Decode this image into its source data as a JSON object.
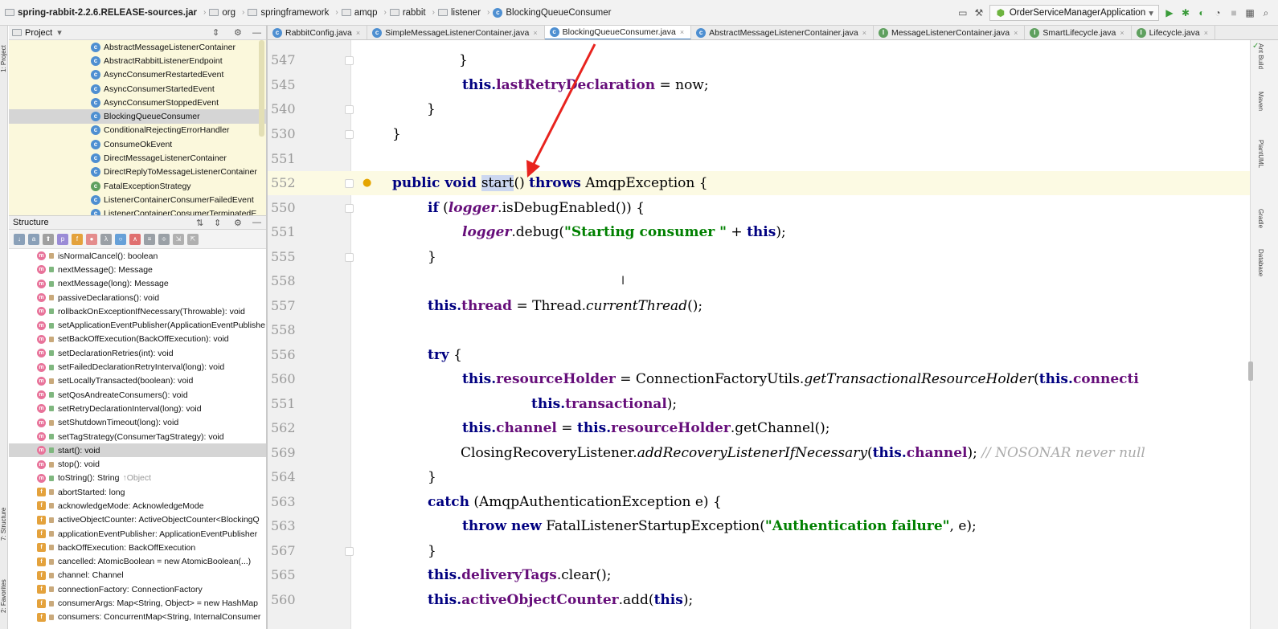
{
  "breadcrumbs": [
    "spring-rabbit-2.2.6.RELEASE-sources.jar",
    "org",
    "springframework",
    "amqp",
    "rabbit",
    "listener",
    "BlockingQueueConsumer"
  ],
  "run_config": "OrderServiceManagerApplication",
  "left_strip": {
    "project": "1: Project",
    "structure": "7: Structure",
    "favorites": "2: Favorites"
  },
  "project_panel": {
    "title": "Project",
    "items": [
      "AbstractMessageListenerContainer",
      "AbstractRabbitListenerEndpoint",
      "AsyncConsumerRestartedEvent",
      "AsyncConsumerStartedEvent",
      "AsyncConsumerStoppedEvent",
      "BlockingQueueConsumer",
      "ConditionalRejectingErrorHandler",
      "ConsumeOkEvent",
      "DirectMessageListenerContainer",
      "DirectReplyToMessageListenerContainer",
      "FatalExceptionStrategy",
      "ListenerContainerConsumerFailedEvent",
      "ListenerContainerConsumerTerminatedE"
    ],
    "selected_index": 5
  },
  "structure_panel": {
    "title": "Structure",
    "methods": [
      "isNormalCancel(): boolean",
      "nextMessage(): Message",
      "nextMessage(long): Message",
      "passiveDeclarations(): void",
      "rollbackOnExceptionIfNecessary(Throwable): void",
      "setApplicationEventPublisher(ApplicationEventPublishe",
      "setBackOffExecution(BackOffExecution): void",
      "setDeclarationRetries(int): void",
      "setFailedDeclarationRetryInterval(long): void",
      "setLocallyTransacted(boolean): void",
      "setQosAndreateConsumers(): void",
      "setRetryDeclarationInterval(long): void",
      "setShutdownTimeout(long): void",
      "setTagStrategy(ConsumerTagStrategy): void",
      "start(): void",
      "stop(): void",
      "toString(): String"
    ],
    "tostring_suffix": "↑Object",
    "selected_index": 14,
    "fields": [
      "abortStarted: long",
      "acknowledgeMode: AcknowledgeMode",
      "activeObjectCounter: ActiveObjectCounter<BlockingQ",
      "applicationEventPublisher: ApplicationEventPublisher",
      "backOffExecution: BackOffExecution",
      "cancelled: AtomicBoolean = new AtomicBoolean(...)",
      "channel: Channel",
      "connectionFactory: ConnectionFactory",
      "consumerArgs: Map<String, Object> = new HashMap",
      "consumers: ConcurrentMap<String, InternalConsumer"
    ]
  },
  "tabs": [
    {
      "label": "RabbitConfig.java",
      "icon": "C"
    },
    {
      "label": "SimpleMessageListenerContainer.java",
      "icon": "C"
    },
    {
      "label": "BlockingQueueConsumer.java",
      "icon": "C",
      "active": true
    },
    {
      "label": "AbstractMessageListenerContainer.java",
      "icon": "C"
    },
    {
      "label": "MessageListenerContainer.java",
      "icon": "I"
    },
    {
      "label": "SmartLifecycle.java",
      "icon": "I"
    },
    {
      "label": "Lifecycle.java",
      "icon": "I"
    }
  ],
  "right_strip": [
    "Ant Build",
    "Maven",
    "PlantUML",
    "Gradle",
    "Database"
  ],
  "code": {
    "line_numbers": [
      "547",
      "545",
      "540",
      "530",
      "551",
      "552",
      "550",
      "551",
      "555",
      "558",
      "557",
      "558",
      "556",
      "560",
      "551",
      "562",
      "569",
      "564",
      "563",
      "563",
      "567",
      "565",
      "560"
    ],
    "t_ln547": "}",
    "t_ln545a": "this.",
    "t_ln545b": "lastRetryDeclaration",
    "t_ln545c": " = now;",
    "t_ln540": "}",
    "t_ln530": "}",
    "t_ln552a": "public void ",
    "t_ln552b": "start",
    "t_ln552c": "() ",
    "t_ln552d": "throws",
    "t_ln552e": " AmqpException {",
    "t_ln550a": "if",
    "t_ln550b": " (",
    "t_ln550c": "logger",
    "t_ln550d": ".isDebugEnabled()) {",
    "t_ln551a": "logger",
    "t_ln551b": ".debug(",
    "t_ln551c": "\"Starting consumer \"",
    "t_ln551d": " + ",
    "t_ln551e": "this",
    "t_ln551f": ");",
    "t_ln555": "}",
    "t_ln557a": "this.",
    "t_ln557b": "thread",
    "t_ln557c": " = Thread.",
    "t_ln557d": "currentThread",
    "t_ln557e": "();",
    "t_ln556a": "try",
    "t_ln556b": " {",
    "t_ln560a": "this.",
    "t_ln560b": "resourceHolder",
    "t_ln560c": " = ConnectionFactoryUtils.",
    "t_ln560d": "getTransactionalResourceHolder",
    "t_ln560e": "(",
    "t_ln560f": "this.",
    "t_ln560g": "connecti",
    "t_ln551ba": "this.",
    "t_ln551bb": "transactional",
    "t_ln551bc": ");",
    "t_ln562a": "this.",
    "t_ln562b": "channel",
    "t_ln562c": " = ",
    "t_ln562d": "this.",
    "t_ln562e": "resourceHolder",
    "t_ln562f": ".getChannel();",
    "t_ln569a": "ClosingRecoveryListener.",
    "t_ln569b": "addRecoveryListenerIfNecessary",
    "t_ln569c": "(",
    "t_ln569d": "this.",
    "t_ln569e": "channel",
    "t_ln569f": "); ",
    "t_ln569g": "// NOSONAR never null",
    "t_ln564": "}",
    "t_ln563a": "catch",
    "t_ln563b": " (AmqpAuthenticationException e) {",
    "t_ln563ba": "throw new",
    "t_ln563bb": " FatalListenerStartupException(",
    "t_ln563bc": "\"Authentication failure\"",
    "t_ln563bd": ", e);",
    "t_ln567": "}",
    "t_ln565a": "this.",
    "t_ln565b": "deliveryTags",
    "t_ln565c": ".clear();",
    "t_ln560za": "this.",
    "t_ln560zb": "activeObjectCounter",
    "t_ln560zc": ".add(",
    "t_ln560zd": "this",
    "t_ln560ze": ");"
  },
  "colors": {
    "accent": "#4a88c7",
    "arrow": "#e8231e",
    "current_line": "#fcfae3",
    "project_bg": "#fbf8dc"
  }
}
